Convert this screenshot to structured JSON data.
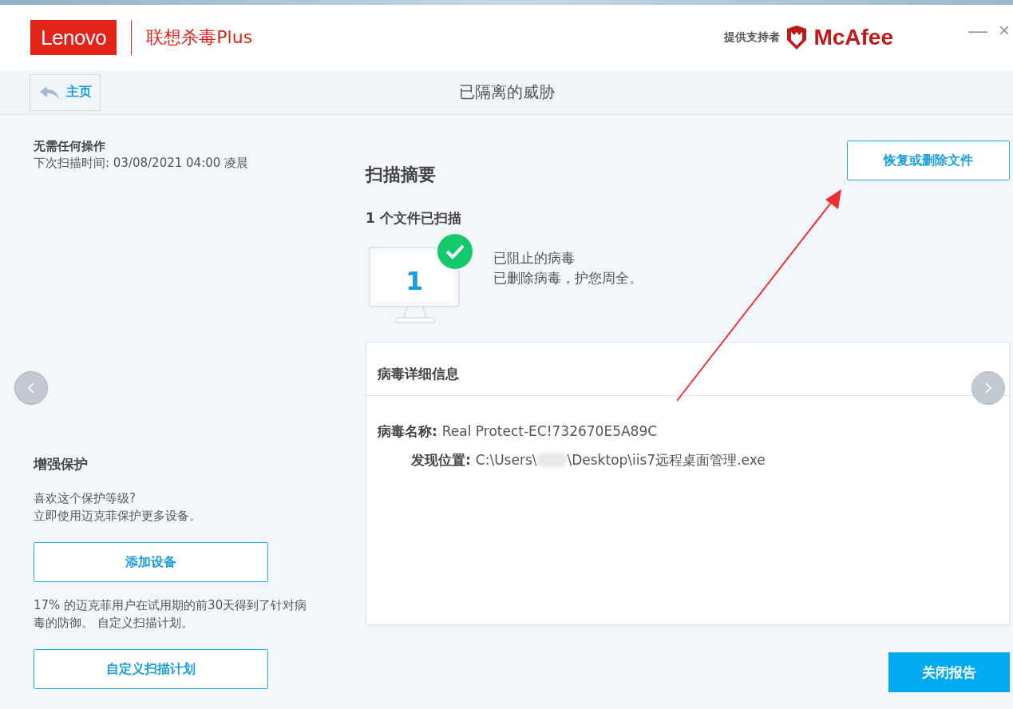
{
  "header": {
    "brand": "Lenovo",
    "product": "联想杀毒Plus",
    "powered_by": "提供支持者",
    "partner": "McAfee",
    "window_controls": [
      "—",
      "×"
    ]
  },
  "nav": {
    "back_label": "主页",
    "title": "已隔离的威胁"
  },
  "status": {
    "title": "无需任何操作",
    "next_scan": "下次扫描时间: 03/08/2021 04:00 凌晨"
  },
  "promo": {
    "title": "增强保护",
    "text_lines": [
      "喜欢这个保护等级?",
      "立即使用迈克菲保护更多设备。"
    ],
    "button": "添加设备",
    "stat": "17% 的迈克菲用户在试用期的前30天得到了针对病毒的防御。 自定义扫描计划。",
    "button2": "自定义扫描计划"
  },
  "summary": {
    "title": "扫描摘要",
    "action_button": "恢复或删除文件",
    "files_scanned": "1 个文件已扫描",
    "count": "1",
    "result_title": "已阻止的病毒",
    "result_text": "已删除病毒，护您周全。"
  },
  "details": {
    "title": "病毒详细信息",
    "fields": [
      {
        "label": "病毒名称:",
        "value": "Real Protect-EC!732670E5A89C",
        "redacted": false
      },
      {
        "label": "发现位置:",
        "value": "C:\\Users\\",
        "value_after": "\\Desktop\\iis7远程桌面管理.exe",
        "redacted": true
      }
    ]
  },
  "close_button": "关闭报告"
}
